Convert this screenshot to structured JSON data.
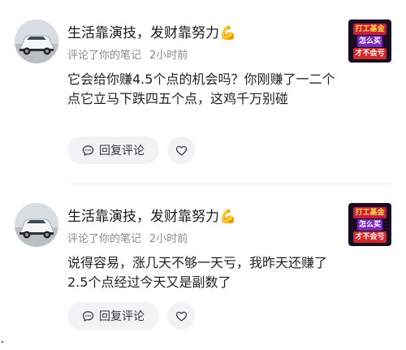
{
  "comments": [
    {
      "username": "生活靠演技，发财靠努力",
      "emoji": "💪",
      "action": "评论了你的笔记",
      "time": "2小时前",
      "text": "它会给你赚4.5个点的机会吗？你刚赚了一二个点它立马下跌四五个点，这鸡千万别碰",
      "reply_label": "回复评论",
      "thumb_lines": [
        "打工基金",
        "怎么买",
        "才不会亏"
      ]
    },
    {
      "username": "生活靠演技，发财靠努力",
      "emoji": "💪",
      "action": "评论了你的笔记",
      "time": "2小时前",
      "text": "说得容易，涨几天不够一天亏，我昨天还赚了2.5个点经过今天又是副数了",
      "reply_label": "回复评论",
      "thumb_lines": [
        "打工基金",
        "怎么买",
        "才不会亏"
      ]
    }
  ],
  "colors": {
    "muscle": "#f5b800",
    "thumb_bg": "#1b0c24",
    "button_bg": "#f3f3f5",
    "meta_text": "#8a8a8a"
  },
  "icons": {
    "reply": "speech-bubble-icon",
    "like": "heart-outline-icon",
    "avatar": "white-car-avatar"
  }
}
